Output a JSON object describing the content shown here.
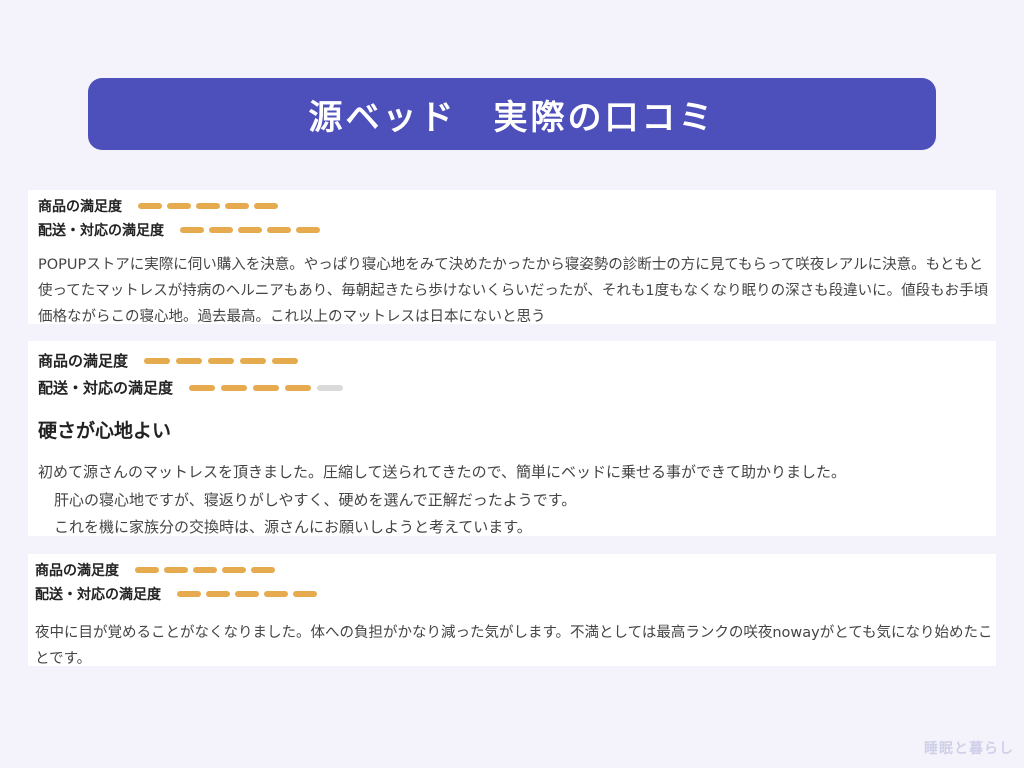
{
  "header": {
    "title": "源ベッド　実際の口コミ"
  },
  "labels": {
    "product": "商品の満足度",
    "delivery": "配送・対応の満足度"
  },
  "reviews": [
    {
      "product_rating": 5,
      "delivery_rating": 5,
      "heading": "",
      "text": "POPUPストアに実際に伺い購入を決意。やっぱり寝心地をみて決めたかったから寝姿勢の診断士の方に見てもらって咲夜レアルに決意。もともと使ってたマットレスが持病のヘルニアもあり、毎朝起きたら歩けないくらいだったが、それも1度もなくなり眠りの深さも段違いに。値段もお手頃価格ながらこの寝心地。過去最高。これ以上のマットレスは日本にないと思う"
    },
    {
      "product_rating": 5,
      "delivery_rating": 4,
      "heading": "硬さが心地よい",
      "lines": [
        "初めて源さんのマットレスを頂きました。圧縮して送られてきたので、簡単にベッドに乗せる事ができて助かりました。",
        "肝心の寝心地ですが、寝返りがしやすく、硬めを選んで正解だったようです。",
        "これを機に家族分の交換時は、源さんにお願いしようと考えています。"
      ]
    },
    {
      "product_rating": 5,
      "delivery_rating": 5,
      "heading": "",
      "text": "夜中に目が覚めることがなくなりました。体への負担がかなり減った気がします。不満としては最高ランクの咲夜nowayがとても気になり始めたことです。"
    }
  ],
  "watermark": "睡眠と暮らし",
  "colors": {
    "banner": "#4d4fbb",
    "bar_filled": "#e5ab4e",
    "bar_empty": "#dadada"
  }
}
